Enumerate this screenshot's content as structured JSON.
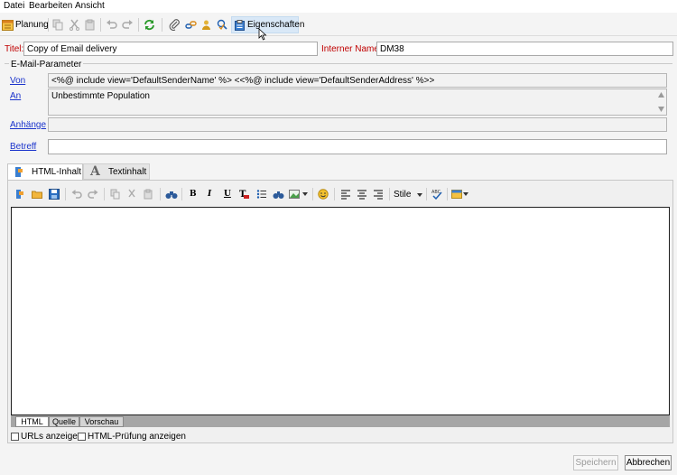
{
  "menu": [
    "Datei",
    "Bearbeiten",
    "Ansicht"
  ],
  "toolbar": {
    "planung": "Planung",
    "eigenschaften": "Eigenschaften"
  },
  "form": {
    "titel_label": "Titel:",
    "titel_value": "Copy of Email delivery",
    "interner_name_label": "Interner Name:",
    "interner_name_value": "DM38",
    "group_title": "E-Mail-Parameter",
    "von_label": "Von",
    "von_value": "<%@ include view='DefaultSenderName' %> <<%@ include view='DefaultSenderAddress' %>>",
    "an_label": "An",
    "an_value": "Unbestimmte Population",
    "anhaenge_label": "Anhänge",
    "anhaenge_value": "",
    "betreff_label": "Betreff",
    "betreff_value": ""
  },
  "tabs": [
    "HTML-Inhalt",
    "Textinhalt"
  ],
  "editor": {
    "bold": "B",
    "italic": "I",
    "underline": "U",
    "style_select": "Stile"
  },
  "mode_tabs": [
    "HTML",
    "Quelle",
    "Vorschau"
  ],
  "options": {
    "urls_label": "URLs anzeigen",
    "html_check_label": "HTML-Prüfung anzeigen"
  },
  "buttons": {
    "save": "Speichern",
    "cancel": "Abbrechen"
  }
}
